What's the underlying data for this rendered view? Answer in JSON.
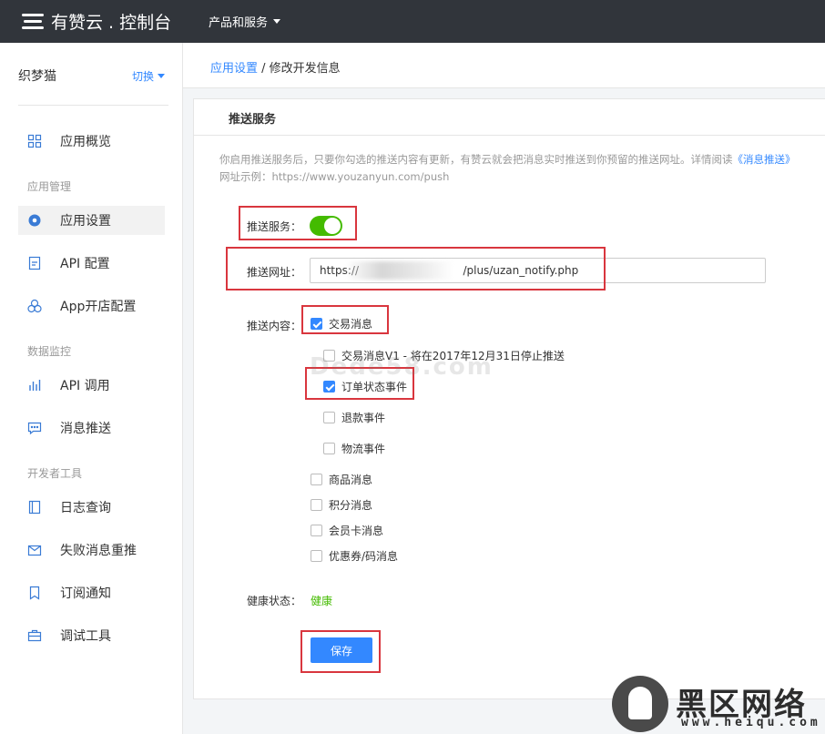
{
  "header": {
    "logo_text": "有赞云 . 控制台",
    "menu_label": "产品和服务"
  },
  "sidebar": {
    "shop_name": "织梦猫",
    "switch_label": "切换",
    "groups": [
      "应用管理",
      "数据监控",
      "开发者工具"
    ],
    "items": [
      {
        "label": "应用概览",
        "icon": "grid-icon"
      },
      {
        "label": "应用设置",
        "icon": "gear-icon",
        "active": true
      },
      {
        "label": "API 配置",
        "icon": "api-doc-icon"
      },
      {
        "label": "App开店配置",
        "icon": "circles-icon"
      },
      {
        "label": "API 调用",
        "icon": "bar-chart-icon"
      },
      {
        "label": "消息推送",
        "icon": "message-icon"
      },
      {
        "label": "日志查询",
        "icon": "book-icon"
      },
      {
        "label": "失败消息重推",
        "icon": "mail-icon"
      },
      {
        "label": "订阅通知",
        "icon": "bookmark-icon"
      },
      {
        "label": "调试工具",
        "icon": "toolbox-icon"
      }
    ]
  },
  "breadcrumb": {
    "parent": "应用设置",
    "separator": " / ",
    "current": "修改开发信息"
  },
  "panel": {
    "title": "推送服务",
    "desc_line1": "你启用推送服务后，只要你勾选的推送内容有更新，有赞云就会把消息实时推送到你预留的推送网址。详情阅读",
    "desc_link": "《消息推送》",
    "desc_line2": "网址示例：https://www.youzanyun.com/push",
    "push_service_label": "推送服务：",
    "push_service_enabled": true,
    "push_url_label": "推送网址：",
    "push_url_value": "https://                              /plus/uzan_notify.php",
    "push_content_label": "推送内容：",
    "options": [
      {
        "label": "交易消息",
        "checked": true
      },
      {
        "label": "交易消息V1 - 将在2017年12月31日停止推送",
        "checked": false
      },
      {
        "label": "订单状态事件",
        "checked": true
      },
      {
        "label": "退款事件",
        "checked": false
      },
      {
        "label": "物流事件",
        "checked": false
      },
      {
        "label": "商品消息",
        "checked": false
      },
      {
        "label": "积分消息",
        "checked": false
      },
      {
        "label": "会员卡消息",
        "checked": false
      },
      {
        "label": "优惠券/码消息",
        "checked": false
      }
    ],
    "health_label": "健康状态：",
    "health_value": "健康",
    "save_label": "保存"
  },
  "watermarks": {
    "middle": "Dede58.com",
    "brand": "黑区网络",
    "url": "www.heiqu.com"
  },
  "colors": {
    "topbar": "#31353b",
    "accent": "#3388ff",
    "success": "#44bb00",
    "highlight": "#d9363e"
  }
}
